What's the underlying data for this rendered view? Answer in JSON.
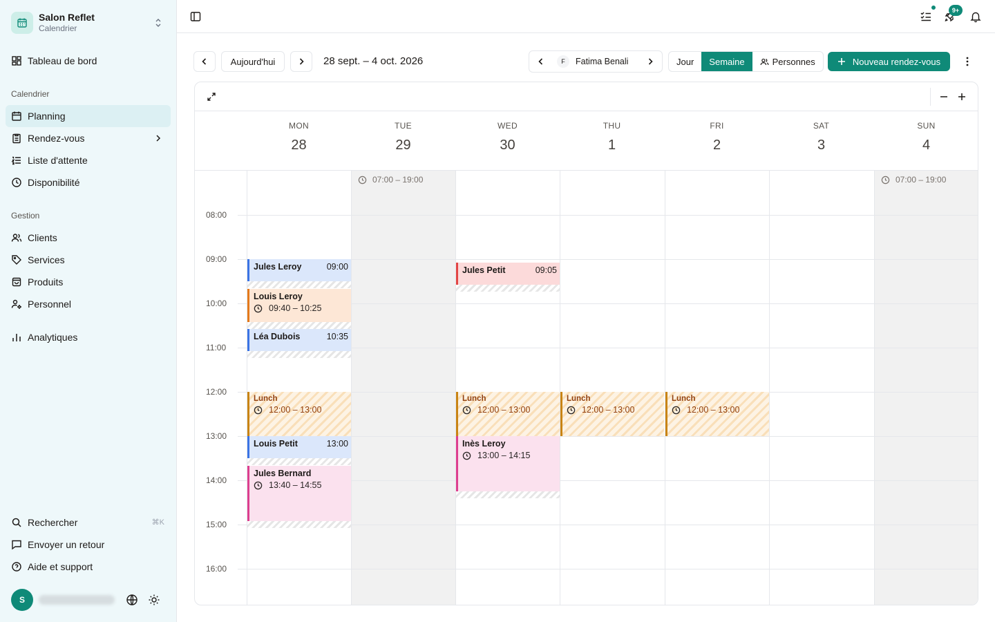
{
  "sidebar": {
    "org_name": "Salon Reflet",
    "org_sub": "Calendrier",
    "dashboard": "Tableau de bord",
    "section_calendar": "Calendrier",
    "planning": "Planning",
    "appointments": "Rendez-vous",
    "waitlist": "Liste d'attente",
    "availability": "Disponibilité",
    "section_management": "Gestion",
    "clients": "Clients",
    "services": "Services",
    "products": "Produits",
    "staff": "Personnel",
    "analytics": "Analytiques",
    "search": "Rechercher",
    "search_shortcut": "⌘K",
    "feedback": "Envoyer un retour",
    "help": "Aide et support",
    "avatar_initial": "S"
  },
  "topbar": {
    "notification_badge": "9+"
  },
  "toolbar": {
    "today": "Aujourd'hui",
    "date_range": "28 sept. – 4 oct. 2026",
    "staff_initial": "F",
    "staff_name": "Fatima Benali",
    "view_day": "Jour",
    "view_week": "Semaine",
    "view_people": "Personnes",
    "new_appointment": "Nouveau rendez-vous"
  },
  "calendar": {
    "days": [
      {
        "name": "MON",
        "num": "28"
      },
      {
        "name": "TUE",
        "num": "29"
      },
      {
        "name": "WED",
        "num": "30"
      },
      {
        "name": "THU",
        "num": "1"
      },
      {
        "name": "FRI",
        "num": "2"
      },
      {
        "name": "SAT",
        "num": "3"
      },
      {
        "name": "SUN",
        "num": "4"
      }
    ],
    "hours": [
      "08:00",
      "09:00",
      "10:00",
      "11:00",
      "12:00",
      "13:00",
      "14:00",
      "15:00",
      "16:00"
    ],
    "closed_hours": "07:00 – 19:00",
    "events": {
      "e1": {
        "name": "Jules Leroy",
        "time": "09:00"
      },
      "e2": {
        "name": "Louis Leroy",
        "time": "09:40 – 10:25"
      },
      "e3": {
        "name": "Léa Dubois",
        "time": "10:35"
      },
      "e4": {
        "name": "Lunch",
        "time": "12:00 – 13:00"
      },
      "e5": {
        "name": "Louis Petit",
        "time": "13:00"
      },
      "e6": {
        "name": "Jules Bernard",
        "time": "13:40 – 14:55"
      },
      "e7": {
        "name": "Jules Petit",
        "time": "09:05"
      },
      "e8": {
        "name": "Lunch",
        "time": "12:00 – 13:00"
      },
      "e9": {
        "name": "Inès Leroy",
        "time": "13:00 – 14:15"
      },
      "e10": {
        "name": "Lunch",
        "time": "12:00 – 13:00"
      },
      "e11": {
        "name": "Lunch",
        "time": "12:00 – 13:00"
      }
    }
  },
  "colors": {
    "accent": "#0f8a78",
    "event_blue": "#3b74e4",
    "event_orange": "#e4791b",
    "event_red": "#e24545",
    "event_pink": "#dd3f8f",
    "lunch": "#c98414"
  }
}
